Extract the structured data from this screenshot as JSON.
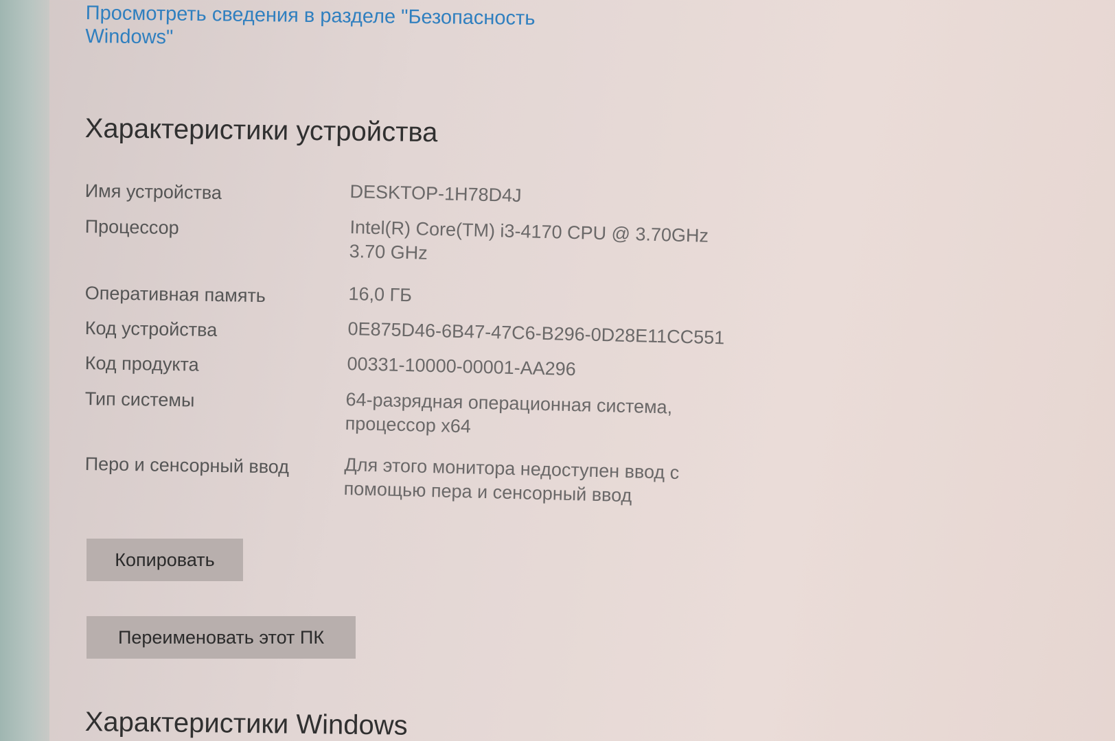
{
  "security_link": "Просмотреть сведения в разделе \"Безопасность Windows\"",
  "device_section": {
    "title": "Характеристики устройства",
    "specs": [
      {
        "label": "Имя устройства",
        "value": "DESKTOP-1H78D4J"
      },
      {
        "label": "Процессор",
        "value": "Intel(R) Core(TM) i3-4170 CPU @ 3.70GHz 3.70 GHz"
      },
      {
        "label": "Оперативная память",
        "value": "16,0 ГБ"
      },
      {
        "label": "Код устройства",
        "value": "0E875D46-6B47-47C6-B296-0D28E11CC551"
      },
      {
        "label": "Код продукта",
        "value": "00331-10000-00001-AA296"
      },
      {
        "label": "Тип системы",
        "value": "64-разрядная операционная система, процессор x64"
      },
      {
        "label": "Перо и сенсорный ввод",
        "value": "Для этого монитора недоступен ввод с помощью пера и сенсорный ввод"
      }
    ],
    "copy_button": "Копировать",
    "rename_button": "Переименовать этот ПК"
  },
  "windows_section": {
    "title": "Характеристики Windows"
  }
}
